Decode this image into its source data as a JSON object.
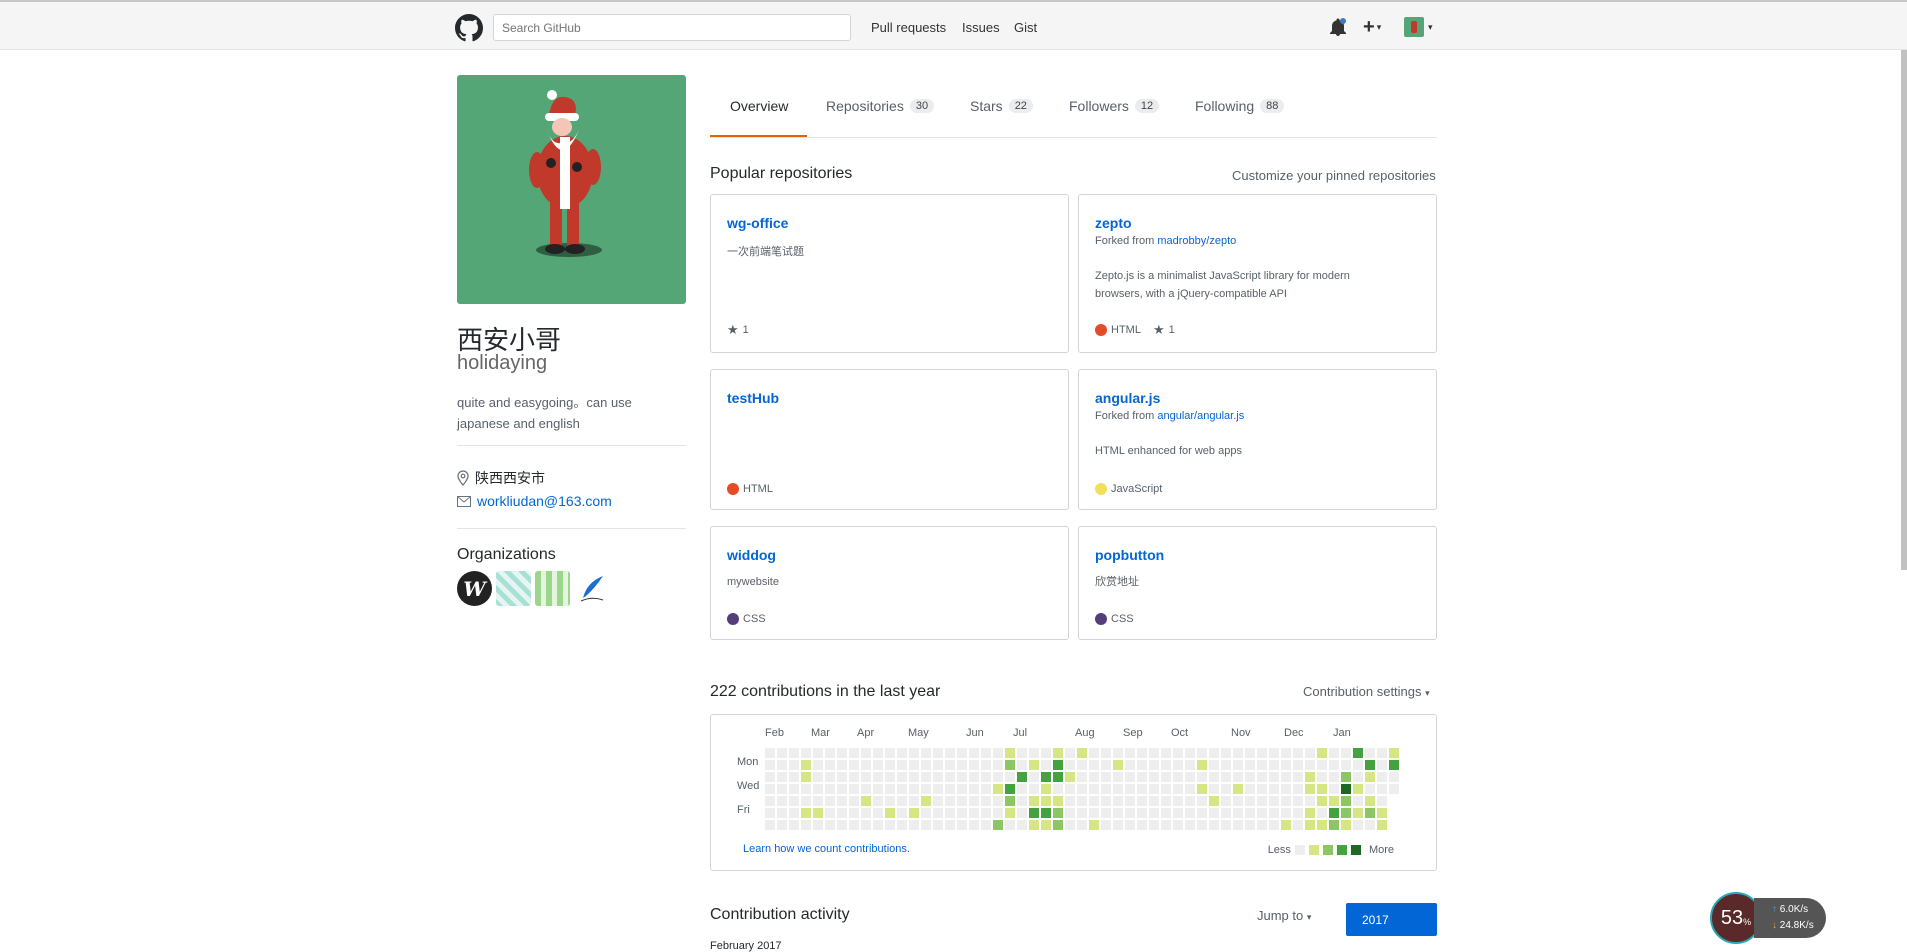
{
  "header": {
    "search_placeholder": "Search GitHub",
    "nav": [
      "Pull requests",
      "Issues",
      "Gist"
    ]
  },
  "profile": {
    "full_name": "西安小哥",
    "username": "holidaying",
    "bio": "quite and easygoing。can use japanese and english",
    "location": "陕西西安市",
    "email": "workliudan@163.com",
    "orgs_title": "Organizations"
  },
  "tabs": [
    {
      "label": "Overview",
      "count": ""
    },
    {
      "label": "Repositories",
      "count": "30"
    },
    {
      "label": "Stars",
      "count": "22"
    },
    {
      "label": "Followers",
      "count": "12"
    },
    {
      "label": "Following",
      "count": "88"
    }
  ],
  "pinned": {
    "title": "Popular repositories",
    "customize": "Customize your pinned repositories",
    "repos": [
      {
        "name": "wg-office",
        "fork_prefix": "",
        "fork_source": "",
        "desc": "一次前端笔试题",
        "lang": "",
        "lang_color": "",
        "stars": "1"
      },
      {
        "name": "zepto",
        "fork_prefix": "Forked from",
        "fork_source": "madrobby/zepto",
        "desc": "Zepto.js is a minimalist JavaScript library for modern browsers, with a jQuery-compatible API",
        "lang": "HTML",
        "lang_color": "#e34c26",
        "stars": "1"
      },
      {
        "name": "testHub",
        "fork_prefix": "",
        "fork_source": "",
        "desc": "",
        "lang": "HTML",
        "lang_color": "#e34c26",
        "stars": ""
      },
      {
        "name": "angular.js",
        "fork_prefix": "Forked from",
        "fork_source": "angular/angular.js",
        "desc": "HTML enhanced for web apps",
        "lang": "JavaScript",
        "lang_color": "#f1e05a",
        "stars": ""
      },
      {
        "name": "widdog",
        "fork_prefix": "",
        "fork_source": "",
        "desc": "mywebsite",
        "lang": "CSS",
        "lang_color": "#563d7c",
        "stars": ""
      },
      {
        "name": "popbutton",
        "fork_prefix": "",
        "fork_source": "",
        "desc": "欣赏地址",
        "lang": "CSS",
        "lang_color": "#563d7c",
        "stars": ""
      }
    ]
  },
  "contributions": {
    "title": "222 contributions in the last year",
    "settings": "Contribution settings",
    "months": [
      "Feb",
      "Mar",
      "Apr",
      "May",
      "Jun",
      "Jul",
      "Aug",
      "Sep",
      "Oct",
      "Nov",
      "Dec",
      "Jan"
    ],
    "days": [
      "Mon",
      "Wed",
      "Fri"
    ],
    "learn": "Learn how we count contributions.",
    "less": "Less",
    "more": "More",
    "colors": [
      "#eeeeee",
      "#d6e685",
      "#8cc665",
      "#44a340",
      "#1e6823"
    ]
  },
  "activity": {
    "title": "Contribution activity",
    "jump": "Jump to",
    "year": "2017",
    "month_note": "February 2017"
  },
  "net_widget": {
    "percent": "53",
    "percent_unit": "%",
    "up": "6.0",
    "down": "24.8",
    "unit": "K/s"
  }
}
